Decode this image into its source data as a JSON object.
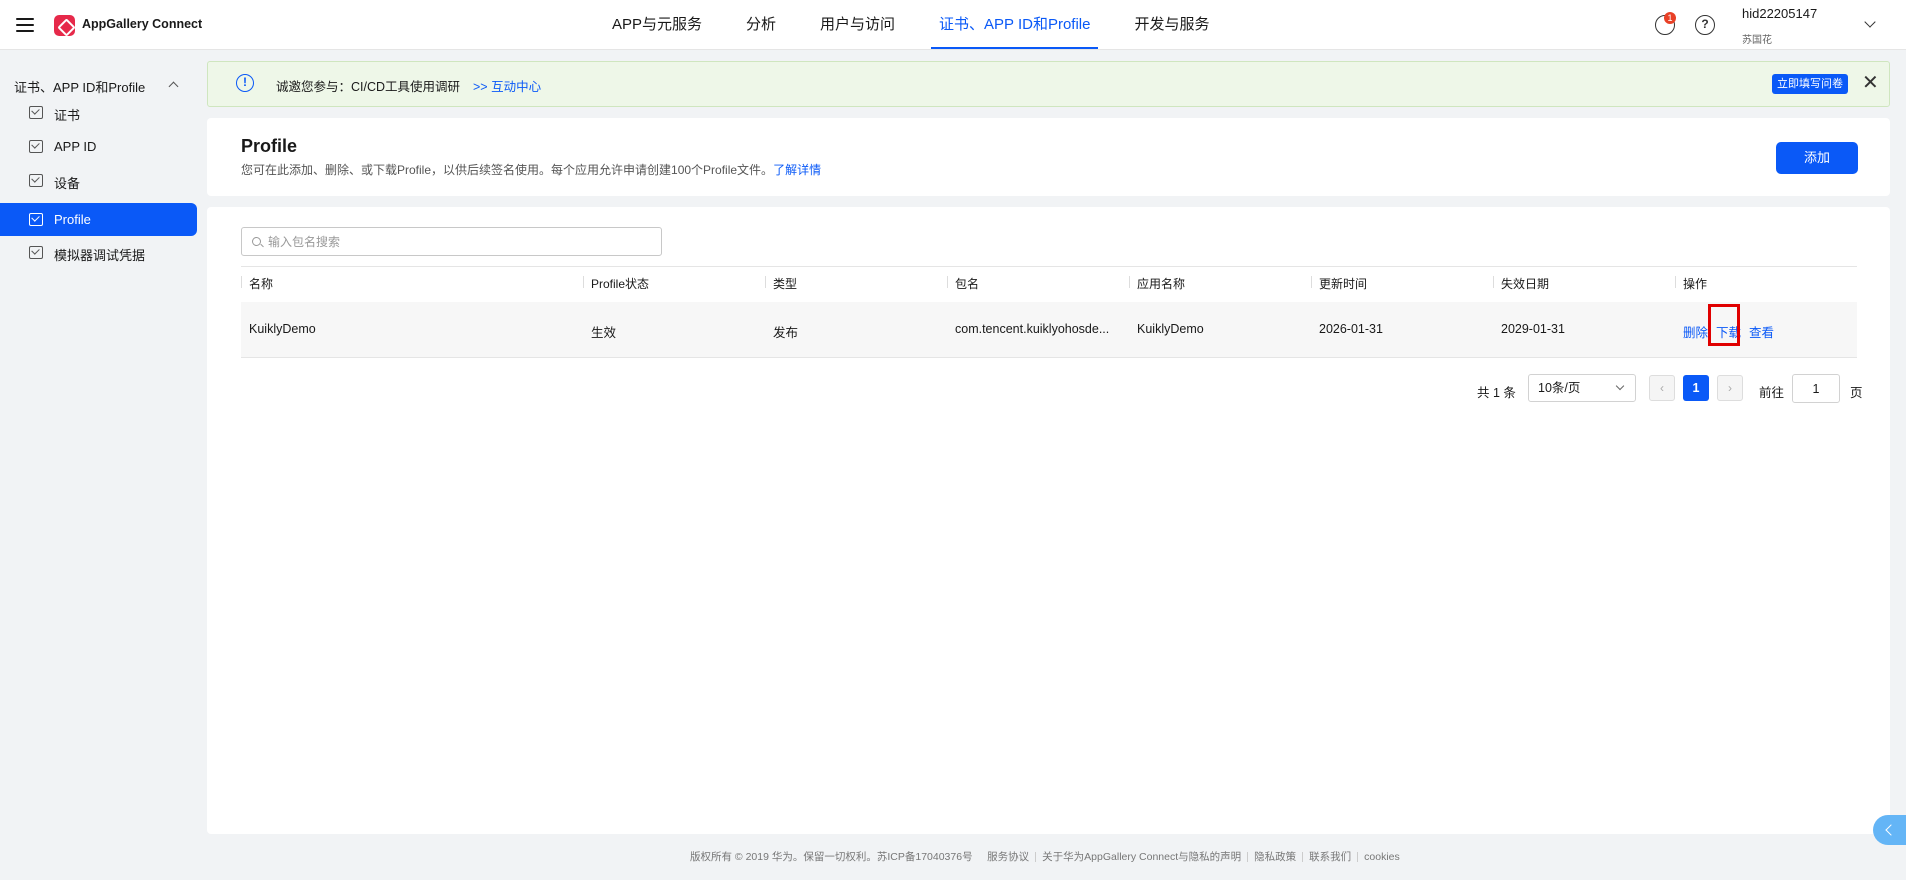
{
  "header": {
    "brand": "AppGallery Connect",
    "nav": [
      {
        "label": "APP与元服务"
      },
      {
        "label": "分析"
      },
      {
        "label": "用户与访问"
      },
      {
        "label": "证书、APP ID和Profile"
      },
      {
        "label": "开发与服务"
      }
    ],
    "active_nav": "证书、APP ID和Profile",
    "notification_count": "1",
    "help_glyph": "?",
    "user_id": "hid22205147",
    "user_name": "苏国花"
  },
  "sidebar": {
    "group_label": "证书、APP ID和Profile",
    "items": [
      {
        "label": "证书"
      },
      {
        "label": "APP ID"
      },
      {
        "label": "设备"
      },
      {
        "label": "Profile"
      },
      {
        "label": "模拟器调试凭据"
      }
    ],
    "active_item": "Profile"
  },
  "banner": {
    "info_glyph": "!",
    "text": "诚邀您参与：CI/CD工具使用调研",
    "link": ">> 互动中心",
    "button": "立即填写问卷",
    "close_glyph": "✕"
  },
  "page": {
    "title": "Profile",
    "description": "您可在此添加、删除、或下载Profile，以供后续签名使用。每个应用允许申请创建100个Profile文件。",
    "learn_more": "了解详情",
    "add_button": "添加"
  },
  "search": {
    "placeholder": "输入包名搜索",
    "value": ""
  },
  "table": {
    "columns": [
      "名称",
      "Profile状态",
      "类型",
      "包名",
      "应用名称",
      "更新时间",
      "失效日期",
      "操作"
    ],
    "rows": [
      {
        "name": "KuiklyDemo",
        "status": "生效",
        "type": "发布",
        "package": "com.tencent.kuiklyohosde...",
        "app_name": "KuiklyDemo",
        "updated": "2026-01-31",
        "expires": "2029-01-31",
        "actions": {
          "delete": "删除",
          "download": "下载",
          "view": "查看"
        }
      }
    ]
  },
  "pagination": {
    "total": "共 1 条",
    "page_size": "10条/页",
    "prev": "‹",
    "current": "1",
    "next": "›",
    "goto_label": "前往",
    "goto_value": "1",
    "page_label": "页"
  },
  "footer": {
    "copyright": "版权所有 © 2019 华为。保留一切权利。苏ICP备17040376号",
    "links": [
      "服务协议",
      "关于华为AppGallery Connect与隐私的声明",
      "隐私政策",
      "联系我们",
      "cookies"
    ]
  },
  "colors": {
    "accent": "#0a59f7",
    "brand": "#e6294a",
    "banner_bg": "#eef7e8",
    "highlight": "#e00000"
  },
  "icons": [
    "menu-icon",
    "appgallery-logo-icon",
    "notification-icon",
    "help-icon",
    "chevron-down-icon",
    "info-icon",
    "close-icon",
    "search-icon",
    "profile-file-icon",
    "collapse-icon"
  ]
}
